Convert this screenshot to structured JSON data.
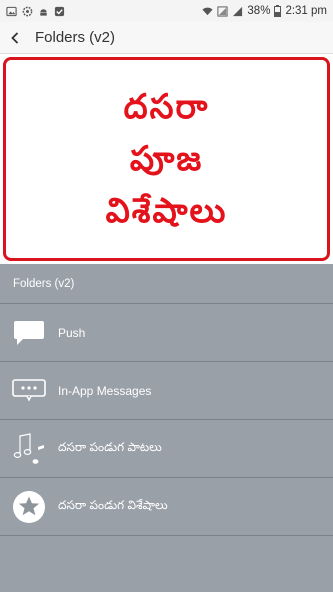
{
  "status_bar": {
    "battery": "38%",
    "time": "2:31 pm"
  },
  "app_bar": {
    "title": "Folders (v2)"
  },
  "banner": {
    "lines": [
      "దసరా",
      "పూజ",
      "విశేషాలు"
    ],
    "border_color": "#d8141c",
    "text_color": "#e3121b"
  },
  "list": {
    "section_title": "Folders (v2)",
    "items": [
      {
        "label": "Push",
        "icon": "chat-bubble-icon"
      },
      {
        "label": "In-App Messages",
        "icon": "message-dots-icon"
      },
      {
        "label": "దసరా పండుగ పాటలు",
        "icon": "music-notes-icon"
      },
      {
        "label": "దసరా పండుగ విశేషాలు",
        "icon": "star-circle-icon"
      }
    ]
  },
  "colors": {
    "list_background": "#9aa0a8",
    "appbar_background": "#f7f7f7"
  }
}
